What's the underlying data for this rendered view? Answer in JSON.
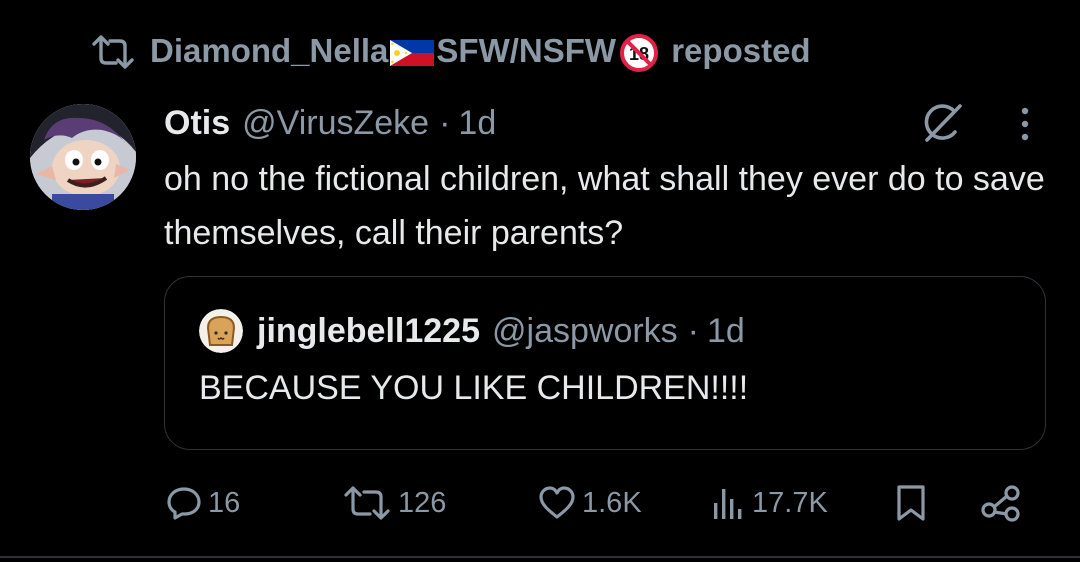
{
  "repost": {
    "icon": "repost-icon",
    "user_name": "Diamond_Nella",
    "flag_icon": "philippines-flag-icon",
    "suffix": "SFW/NSFW",
    "badge_icon": "no-under-18-icon",
    "label": "reposted"
  },
  "post": {
    "display_name": "Otis",
    "handle": "@VirusZeke",
    "time": "1d",
    "text": "oh no the fictional children, what shall they ever do to save themselves, call their parents?",
    "avatar_icon": "cartoon-character-avatar",
    "grok_icon": "grok-icon",
    "more_icon": "more-vertical-icon"
  },
  "quote": {
    "display_name": "jinglebell1225",
    "handle": "@jaspworks",
    "time": "1d",
    "text": "BECAUSE YOU LIKE CHILDREN!!!!",
    "avatar_icon": "toast-avatar"
  },
  "actions": {
    "replies": "16",
    "reposts": "126",
    "likes": "1.6K",
    "views": "17.7K"
  },
  "colors": {
    "background": "#000000",
    "text": "#e7e9ea",
    "muted": "#8b98a5",
    "border": "#2f3336"
  }
}
